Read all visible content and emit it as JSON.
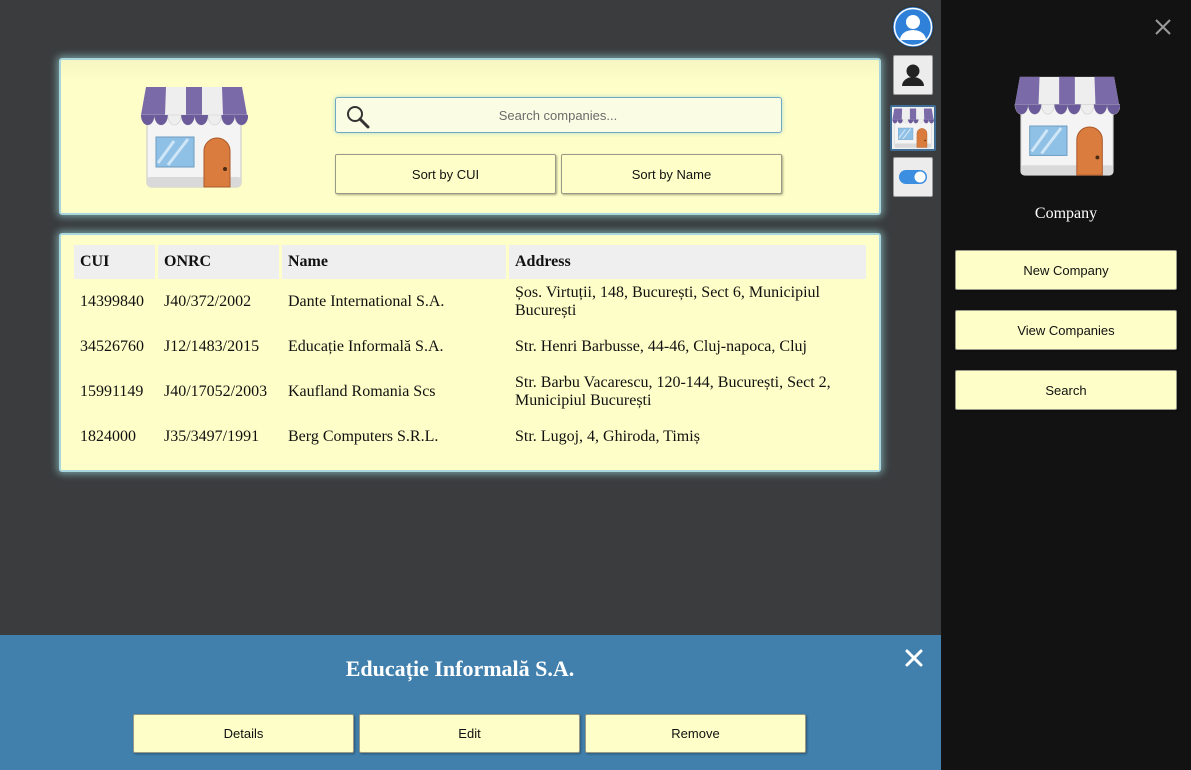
{
  "search": {
    "placeholder": "Search companies..."
  },
  "sort": {
    "by_cui": "Sort by CUI",
    "by_name": "Sort by Name"
  },
  "table": {
    "headers": [
      "CUI",
      "ONRC",
      "Name",
      "Address"
    ],
    "rows": [
      [
        "14399840",
        "J40/372/2002",
        "Dante International S.A.",
        "Șos. Virtuții, 148, București, Sect 6, Municipiul București"
      ],
      [
        "34526760",
        "J12/1483/2015",
        "Educație Informală S.A.",
        "Str. Henri Barbusse, 44-46, Cluj-napoca, Cluj"
      ],
      [
        "15991149",
        "J40/17052/2003",
        "Kaufland Romania Scs",
        "Str. Barbu Vacarescu, 120-144, București, Sect 2, Municipiul București"
      ],
      [
        "1824000",
        "J35/3497/1991",
        "Berg Computers S.R.L.",
        "Str. Lugoj, 4, Ghiroda, Timiș"
      ]
    ]
  },
  "selection": {
    "title": "Educație Informală S.A.",
    "details": "Details",
    "edit": "Edit",
    "remove": "Remove"
  },
  "sidebar": {
    "label": "Company",
    "new_company": "New Company",
    "view_companies": "View Companies",
    "search": "Search"
  },
  "icons": {
    "avatar": "user-avatar-icon",
    "person": "person-silhouette-icon",
    "company": "store-icon",
    "toggle": "toggle-switch-icon",
    "close": "close-icon",
    "search": "magnifier-icon"
  },
  "colors": {
    "panel_bg": "#fefec8",
    "panel_glow": "#a9d6dc",
    "action_bar": "#4180ad",
    "sidebar_bg": "#121212",
    "avatar": "#2f80d8"
  }
}
